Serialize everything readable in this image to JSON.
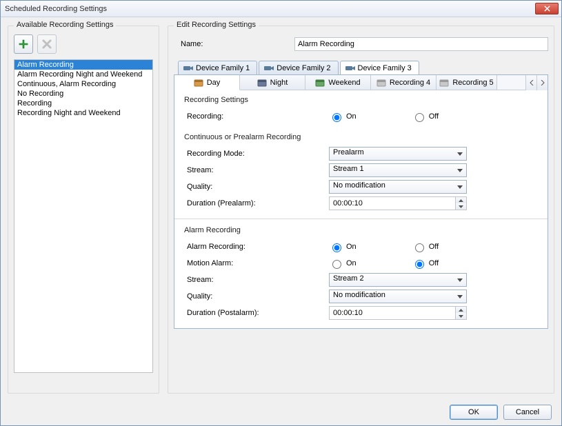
{
  "window": {
    "title": "Scheduled Recording Settings"
  },
  "left": {
    "legend": "Available Recording Settings",
    "items": [
      "Alarm Recording",
      "Alarm Recording Night and Weekend",
      "Continuous, Alarm Recording",
      "No Recording",
      "Recording",
      "Recording Night and Weekend"
    ],
    "selected_index": 0
  },
  "right": {
    "legend": "Edit Recording Settings",
    "name_label": "Name:",
    "name_value": "Alarm Recording",
    "device_tabs": [
      "Device Family 1",
      "Device Family 2",
      "Device Family 3"
    ],
    "device_active": 2,
    "day_tabs": [
      "Day",
      "Night",
      "Weekend",
      "Recording 4",
      "Recording 5"
    ],
    "day_active": 0,
    "sections": {
      "rec_settings_legend": "Recording Settings",
      "recording_label": "Recording:",
      "on": "On",
      "off": "Off",
      "recording_value": "On",
      "cont_legend": "Continuous or Prealarm Recording",
      "mode_label": "Recording Mode:",
      "mode_value": "Prealarm",
      "stream_label": "Stream:",
      "stream1_value": "Stream 1",
      "quality_label": "Quality:",
      "quality_value": "No modification",
      "dur_pre_label": "Duration (Prealarm):",
      "dur_pre_value": "00:00:10",
      "alarm_legend": "Alarm Recording",
      "alarm_rec_label": "Alarm Recording:",
      "alarm_rec_value": "On",
      "motion_label": "Motion Alarm:",
      "motion_value": "Off",
      "stream2_value": "Stream 2",
      "dur_post_label": "Duration (Postalarm):",
      "dur_post_value": "00:00:10"
    }
  },
  "footer": {
    "ok": "OK",
    "cancel": "Cancel"
  }
}
